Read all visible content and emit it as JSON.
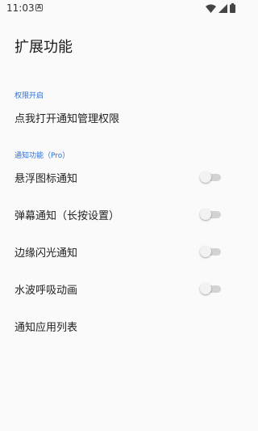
{
  "status_bar": {
    "time": "11:03",
    "notification_icon": "a-badge-icon",
    "wifi_icon": "wifi-icon",
    "signal_icon": "cell-signal-icon",
    "battery_icon": "battery-icon"
  },
  "page": {
    "title": "扩展功能"
  },
  "sections": {
    "permission": {
      "header": "权限开启",
      "item_label": "点我打开通知管理权限"
    },
    "notification": {
      "header": "通知功能（Pro）",
      "items": [
        {
          "label": "悬浮图标通知",
          "enabled": false
        },
        {
          "label": "弹幕通知（长按设置）",
          "enabled": false
        },
        {
          "label": "边缘闪光通知",
          "enabled": false
        },
        {
          "label": "水波呼吸动画",
          "enabled": false
        }
      ],
      "list_item_label": "通知应用列表"
    }
  },
  "colors": {
    "accent": "#2f6fd6",
    "background": "#fafafa",
    "switch_track_off": "#d3d3d3",
    "switch_thumb_off": "#f2f2f2"
  }
}
